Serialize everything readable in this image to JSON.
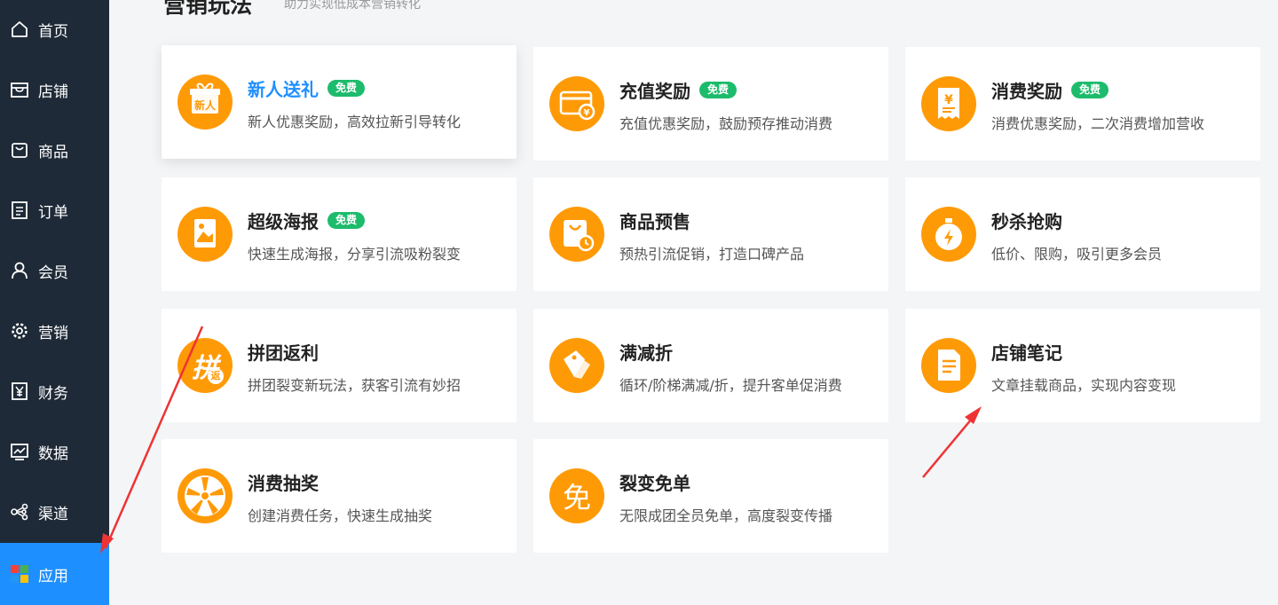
{
  "sidebar": {
    "items": [
      {
        "label": "首页",
        "icon": "home-icon"
      },
      {
        "label": "店铺",
        "icon": "store-icon"
      },
      {
        "label": "商品",
        "icon": "bag-icon"
      },
      {
        "label": "订单",
        "icon": "order-icon"
      },
      {
        "label": "会员",
        "icon": "user-icon"
      },
      {
        "label": "营销",
        "icon": "gear-icon"
      },
      {
        "label": "财务",
        "icon": "yuan-icon"
      },
      {
        "label": "数据",
        "icon": "chart-icon"
      },
      {
        "label": "渠道",
        "icon": "share-icon"
      },
      {
        "label": "应用",
        "icon": "apps-icon",
        "active": true
      }
    ]
  },
  "header": {
    "title": "营销玩法",
    "subtitle": "助力实现低成本营销转化"
  },
  "cards": [
    {
      "title": "新人送礼",
      "badge": "免费",
      "desc": "新人优惠奖励，高效拉新引导转化",
      "icon": "gift-icon",
      "icon_text": "新人"
    },
    {
      "title": "充值奖励",
      "badge": "免费",
      "desc": "充值优惠奖励，鼓励预存推动消费",
      "icon": "recharge-card-icon"
    },
    {
      "title": "消费奖励",
      "badge": "免费",
      "desc": "消费优惠奖励，二次消费增加营收",
      "icon": "receipt-icon"
    },
    {
      "title": "超级海报",
      "badge": "免费",
      "desc": "快速生成海报，分享引流吸粉裂变",
      "icon": "poster-icon"
    },
    {
      "title": "商品预售",
      "badge": "",
      "desc": "预热引流促销，打造口碑产品",
      "icon": "presale-bag-icon"
    },
    {
      "title": "秒杀抢购",
      "badge": "",
      "desc": "低价、限购，吸引更多会员",
      "icon": "stopwatch-icon"
    },
    {
      "title": "拼团返利",
      "badge": "",
      "desc": "拼团裂变新玩法，获客引流有妙招",
      "icon": "group-rebate-icon",
      "icon_text": "拼",
      "icon_sub": "返"
    },
    {
      "title": "满减折",
      "badge": "",
      "desc": "循环/阶梯满减/折，提升客单促消费",
      "icon": "tags-icon"
    },
    {
      "title": "店铺笔记",
      "badge": "",
      "desc": "文章挂载商品，实现内容变现",
      "icon": "note-icon"
    },
    {
      "title": "消费抽奖",
      "badge": "",
      "desc": "创建消费任务，快速生成抽奖",
      "icon": "lottery-wheel-icon"
    },
    {
      "title": "裂变免单",
      "badge": "",
      "desc": "无限成团全员免单，高度裂变传播",
      "icon": "free-order-icon",
      "icon_text": "免"
    }
  ],
  "colors": {
    "sidebar_bg": "#1f2a38",
    "active": "#1e8fff",
    "icon_orange": "#ff9a07",
    "badge_green": "#1dbb6c",
    "arrow_red": "#ee3333"
  }
}
